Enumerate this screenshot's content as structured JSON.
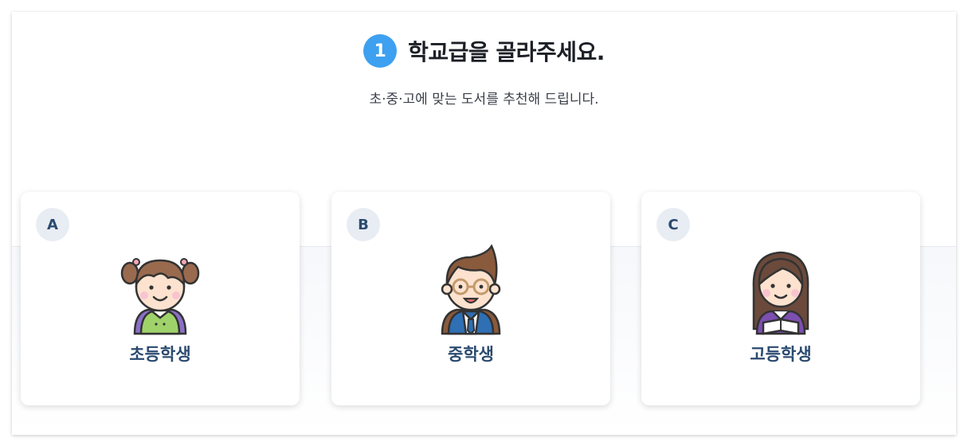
{
  "header": {
    "step_number": "1",
    "title": "학교급을 골라주세요.",
    "subtitle": "초·중·고에 맞는 도서를 추천해 드립니다."
  },
  "cards": [
    {
      "letter": "A",
      "label": "초등학생",
      "icon": "elementary-girl-icon"
    },
    {
      "letter": "B",
      "label": "중학생",
      "icon": "middle-school-boy-icon"
    },
    {
      "letter": "C",
      "label": "고등학생",
      "icon": "high-school-girl-icon"
    }
  ],
  "colors": {
    "accent": "#3ea0f0",
    "label": "#2b4a6f",
    "badge_bg": "#e8edf3"
  }
}
